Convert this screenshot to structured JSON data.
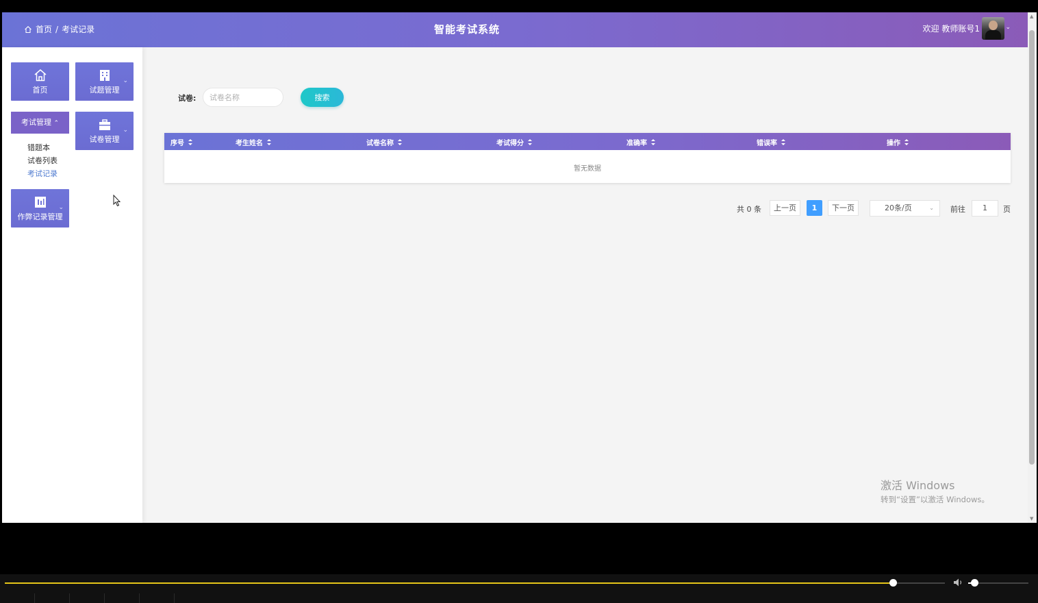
{
  "header": {
    "breadcrumb": {
      "home": "首页",
      "separator": "/",
      "current": "考试记录"
    },
    "title": "智能考试系统",
    "welcome": "欢迎 教师账号1",
    "avatar_chevron": "⌄"
  },
  "sidebar": {
    "tiles": {
      "home": "首页",
      "question_mgmt": "试题管理",
      "exam_mgmt": "考试管理",
      "exam_mgmt_chevron": "⌃",
      "paper_mgmt": "试卷管理",
      "cheat_mgmt": "作弊记录管理",
      "chevron": "⌄"
    },
    "submenu": [
      "错题本",
      "试卷列表",
      "考试记录"
    ],
    "active_submenu": "考试记录"
  },
  "search": {
    "label": "试卷:",
    "placeholder": "试卷名称",
    "button": "搜索"
  },
  "table": {
    "columns": [
      "序号",
      "考生姓名",
      "试卷名称",
      "考试得分",
      "准确率",
      "错误率",
      "操作"
    ],
    "empty_text": "暂无数据"
  },
  "pagination": {
    "total": "共 0 条",
    "prev": "上一页",
    "current_page": "1",
    "next": "下一页",
    "page_size": "20条/页",
    "goto_label": "前往",
    "goto_value": "1",
    "goto_suffix": "页"
  },
  "watermark": {
    "line1": "激活 Windows",
    "line2": "转到“设置”以激活 Windows。"
  },
  "player": {
    "seek_progress": 0.945,
    "volume": 0.1,
    "accent": "#e6c619"
  },
  "colors": {
    "header_gradient_start": "#6b73d6",
    "header_gradient_end": "#8b5bb8",
    "tile": "#6f74d9",
    "search_button": "#1ec8c8",
    "active_page": "#409eff",
    "active_submenu": "#4f7bd0"
  }
}
